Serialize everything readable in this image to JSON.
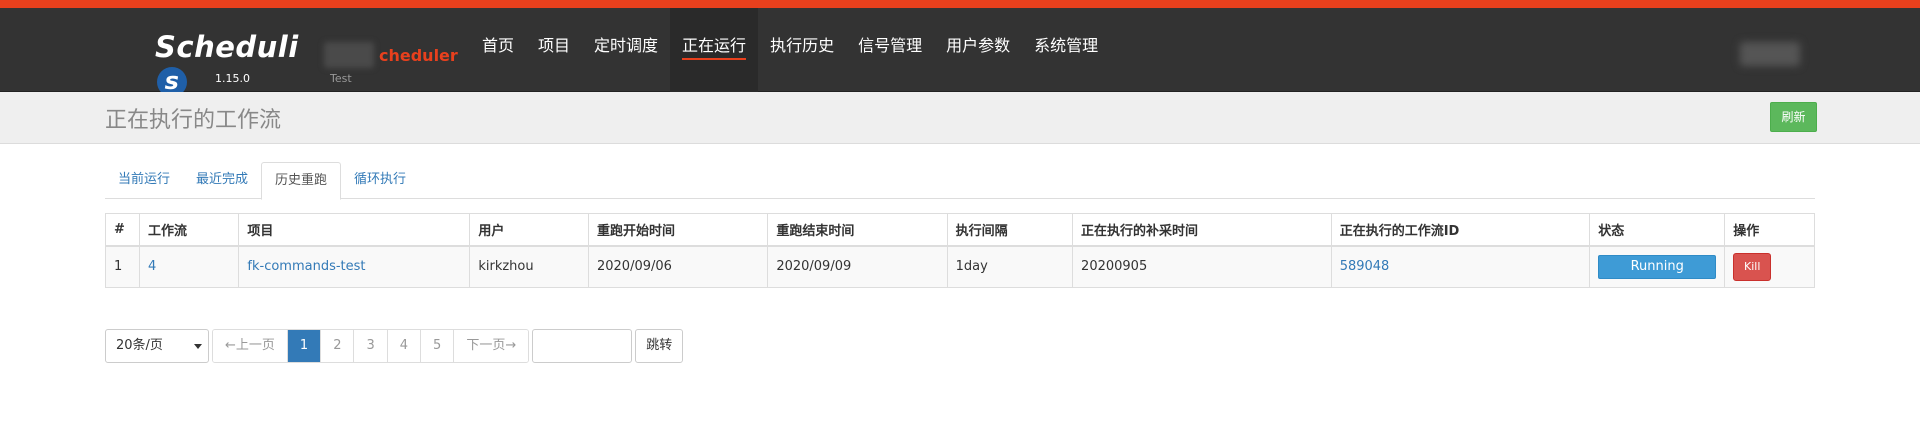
{
  "brand": {
    "word": "Scheduli",
    "s_letter": "s",
    "version": "1.15.0"
  },
  "env": {
    "name": "cheduler",
    "sub": "Test"
  },
  "nav": [
    {
      "label": "首页"
    },
    {
      "label": "项目"
    },
    {
      "label": "定时调度"
    },
    {
      "label": "正在运行",
      "active": true
    },
    {
      "label": "执行历史"
    },
    {
      "label": "信号管理"
    },
    {
      "label": "用户参数"
    },
    {
      "label": "系统管理"
    }
  ],
  "page": {
    "title": "正在执行的工作流",
    "refresh_label": "刷新"
  },
  "tabs": [
    {
      "label": "当前运行"
    },
    {
      "label": "最近完成"
    },
    {
      "label": "历史重跑",
      "active": true
    },
    {
      "label": "循环执行"
    }
  ],
  "table": {
    "headers": [
      "#",
      "工作流",
      "项目",
      "用户",
      "重跑开始时间",
      "重跑结束时间",
      "执行间隔",
      "正在执行的补采时间",
      "正在执行的工作流ID",
      "状态",
      "操作"
    ],
    "rows": [
      {
        "index": "1",
        "flow": "4",
        "project": "fk-commands-test",
        "user": "kirkzhou",
        "rerun_start": "2020/09/06",
        "rerun_end": "2020/09/09",
        "interval": "1day",
        "backfill_time": "20200905",
        "exec_id": "589048",
        "status": "Running",
        "action": "Kill"
      }
    ]
  },
  "pager": {
    "page_size": "20条/页",
    "prev": "←上一页",
    "pages": [
      "1",
      "2",
      "3",
      "4",
      "5"
    ],
    "current": "1",
    "next": "下一页→",
    "jump_label": "跳转"
  },
  "colors": {
    "accent": "#e8401d",
    "navbar": "#333333",
    "primary": "#337ab7",
    "success": "#5cb85c",
    "danger": "#d9534f",
    "running": "#3e9bd6"
  }
}
